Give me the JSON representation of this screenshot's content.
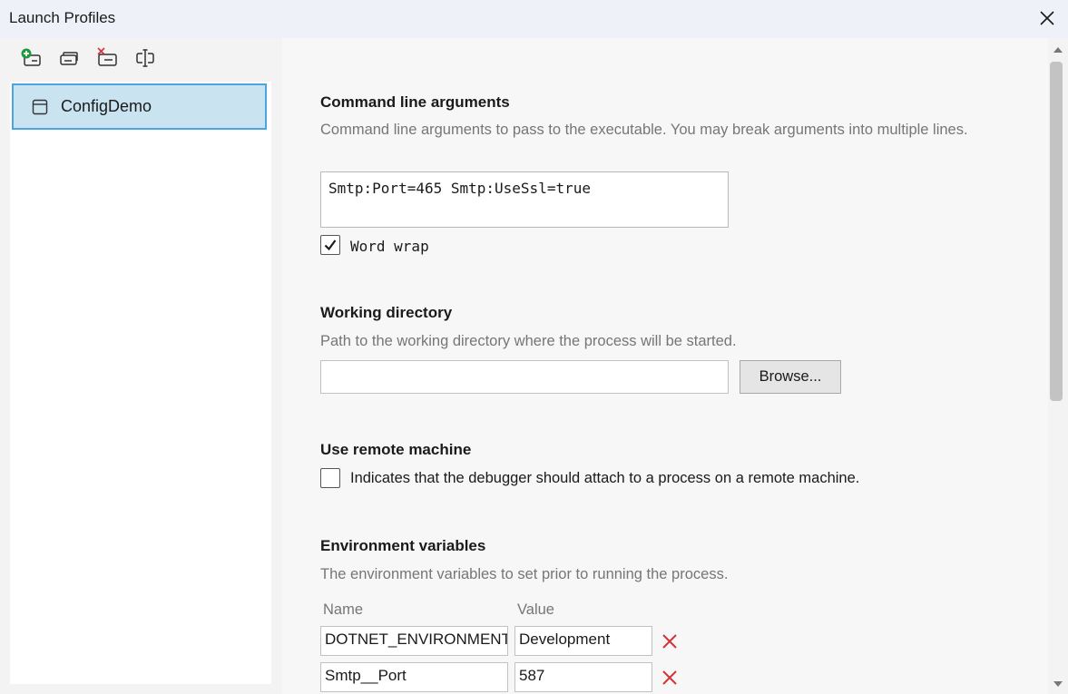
{
  "window": {
    "title": "Launch Profiles"
  },
  "profiles": [
    {
      "label": "ConfigDemo"
    }
  ],
  "sections": {
    "cmdline": {
      "title": "Command line arguments",
      "description": "Command line arguments to pass to the executable. You may break arguments into multiple lines.",
      "value": "Smtp:Port=465 Smtp:UseSsl=true",
      "wordwrap_label": "Word wrap",
      "wordwrap_checked": true
    },
    "workdir": {
      "title": "Working directory",
      "description": "Path to the working directory where the process will be started.",
      "value": "",
      "browse_label": "Browse..."
    },
    "remote": {
      "title": "Use remote machine",
      "checkbox_label": "Indicates that the debugger should attach to a process on a remote machine.",
      "checked": false
    },
    "env": {
      "title": "Environment variables",
      "description": "The environment variables to set prior to running the process.",
      "name_header": "Name",
      "value_header": "Value",
      "rows": [
        {
          "name": "DOTNET_ENVIRONMENT",
          "value": "Development"
        },
        {
          "name": "Smtp__Port",
          "value": "587"
        }
      ]
    }
  },
  "icons": {
    "add_profile": "add-profile-icon",
    "copy_profile": "copy-profile-icon",
    "delete_profile": "delete-profile-icon",
    "rename_profile": "rename-profile-icon",
    "close": "close-icon",
    "remove_row": "remove-icon"
  },
  "colors": {
    "accent": "#4aa6e0",
    "selection": "#c9e3f1",
    "remove": "#d13438",
    "add": "#1e9a3c"
  }
}
